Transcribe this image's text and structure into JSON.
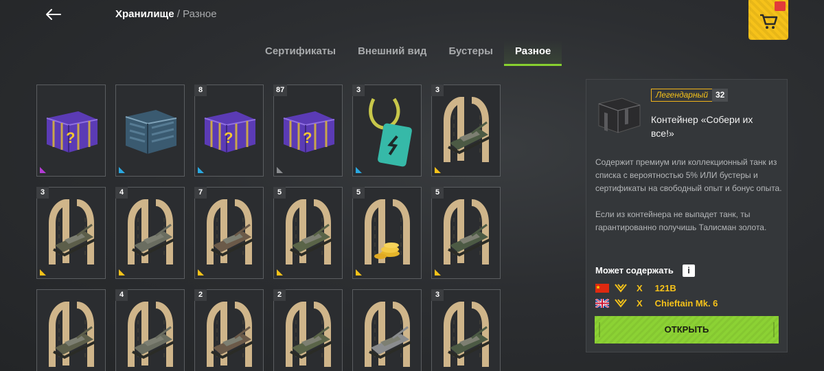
{
  "header": {
    "back_icon": "arrow-left-icon",
    "breadcrumb_current": "Хранилище",
    "breadcrumb_separator": "/",
    "breadcrumb_section": "Разное",
    "shop_icon": "shopping-cart-icon"
  },
  "tabs": [
    {
      "label": "Сертификаты",
      "active": false
    },
    {
      "label": "Внешний вид",
      "active": false
    },
    {
      "label": "Бустеры",
      "active": false
    },
    {
      "label": "Разное",
      "active": true
    }
  ],
  "colors": {
    "accent": "#88d12f",
    "gold": "#f6c21a",
    "rarity_purple": "#b43bd6",
    "rarity_blue": "#2aa8e0",
    "rarity_gray": "#8a8c8f",
    "rarity_yellow": "#f6c21a"
  },
  "items": [
    {
      "count": "",
      "kind": "chest-purple",
      "rarity": "purple"
    },
    {
      "count": "",
      "kind": "chest-steel",
      "rarity": "blue"
    },
    {
      "count": "8",
      "kind": "chest-purple",
      "rarity": "blue"
    },
    {
      "count": "87",
      "kind": "chest-purple",
      "rarity": "gray"
    },
    {
      "count": "3",
      "kind": "pass-card",
      "rarity": "blue"
    },
    {
      "count": "3",
      "kind": "horseshoe-tank",
      "rarity": "yellow"
    },
    {
      "count": "3",
      "kind": "horseshoe-tank",
      "rarity": "yellow"
    },
    {
      "count": "4",
      "kind": "horseshoe-tank",
      "rarity": "yellow"
    },
    {
      "count": "7",
      "kind": "horseshoe-tank",
      "rarity": "yellow"
    },
    {
      "count": "5",
      "kind": "horseshoe-tank",
      "rarity": "yellow"
    },
    {
      "count": "5",
      "kind": "horseshoe-gold",
      "rarity": "yellow"
    },
    {
      "count": "5",
      "kind": "horseshoe-tank",
      "rarity": "yellow"
    },
    {
      "count": "",
      "kind": "horseshoe-tank",
      "rarity": "yellow"
    },
    {
      "count": "4",
      "kind": "horseshoe-tank",
      "rarity": "yellow"
    },
    {
      "count": "2",
      "kind": "horseshoe-tank",
      "rarity": "yellow"
    },
    {
      "count": "2",
      "kind": "horseshoe-tank",
      "rarity": "yellow"
    },
    {
      "count": "",
      "kind": "horseshoe-tank",
      "rarity": "yellow"
    },
    {
      "count": "3",
      "kind": "horseshoe-tank",
      "rarity": "yellow"
    }
  ],
  "detail": {
    "rarity_label": "Легендарный",
    "count": "32",
    "title": "Контейнер «Собери их все!»",
    "description_1": "Содержит премиум или коллекционный танк из списка с вероятностью 5% ИЛИ бустеры и сертификаты на свободный опыт и бонус опыта.",
    "description_2": "Если из контейнера не выпадет танк, ты гарантированно получишь Талисман золота.",
    "contains_label": "Может содержать",
    "info_icon": "i",
    "rewards": [
      {
        "flag": "china-flag-icon",
        "x": "X",
        "name": "121B"
      },
      {
        "flag": "uk-flag-icon",
        "x": "X",
        "name": "Chieftain Mk. 6"
      }
    ],
    "open_label": "ОТКРЫТЬ"
  }
}
